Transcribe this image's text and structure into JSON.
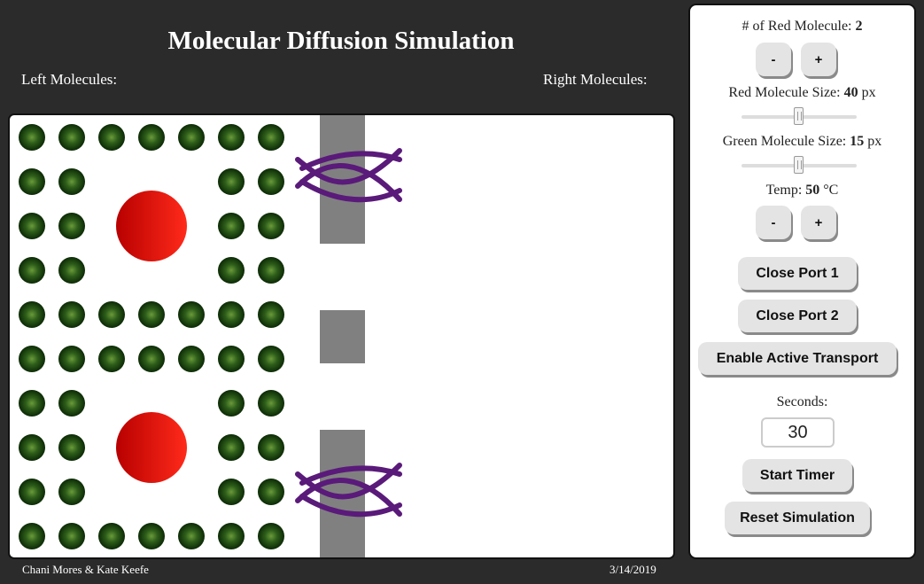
{
  "title": "Molecular Diffusion Simulation",
  "labels": {
    "left": "Left Molecules:",
    "right": "Right Molecules:"
  },
  "footer": {
    "authors": "Chani Mores & Kate Keefe",
    "date": "3/14/2019"
  },
  "controls": {
    "red_count_label": "# of Red Molecule:",
    "red_count_value": "2",
    "minus": "-",
    "plus": "+",
    "red_size_label": "Red Molecule Size:",
    "red_size_value": "40",
    "green_size_label": "Green Molecule Size:",
    "green_size_value": "15",
    "size_unit": "px",
    "temp_label": "Temp:",
    "temp_value": "50",
    "temp_unit": "°C",
    "close_port1": "Close  Port 1",
    "close_port2": "Close  Port 2",
    "active_transport": "Enable  Active  Transport",
    "seconds_label": "Seconds:",
    "seconds_value": "30",
    "start_timer": "Start  Timer",
    "reset": "Reset Simulation"
  },
  "colors": {
    "green_molecule": "#1e4d12",
    "red_molecule": "#ee1111",
    "membrane": "#808080",
    "channel_protein": "#5a1a7a",
    "background": "#2b2b2b"
  }
}
